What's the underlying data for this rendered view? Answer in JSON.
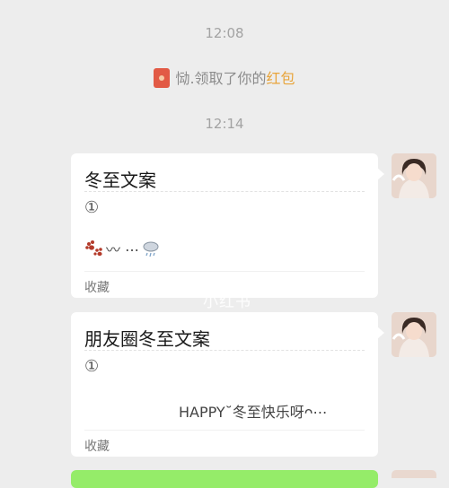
{
  "timestamps": [
    "12:08",
    "12:14"
  ],
  "system_message": {
    "prefix": "恸.领取了你的",
    "highlight": "红包"
  },
  "cards": [
    {
      "title": "冬至文案",
      "number": "①",
      "content_text": "〰 ⋯",
      "footer": "收藏"
    },
    {
      "title": "朋友圈冬至文案",
      "number": "①",
      "content_text": "HAPPY˘冬至快乐呀ᴖ⋯",
      "footer": "收藏"
    }
  ],
  "watermark": "小红书",
  "colors": {
    "background": "#ededed",
    "bubble": "#ffffff",
    "accent": "#e8a43a",
    "green": "#95ec69"
  },
  "icons": {
    "red_packet": "red-packet-icon",
    "paw": "paw-icon",
    "cloud": "cloud-rain-icon"
  }
}
